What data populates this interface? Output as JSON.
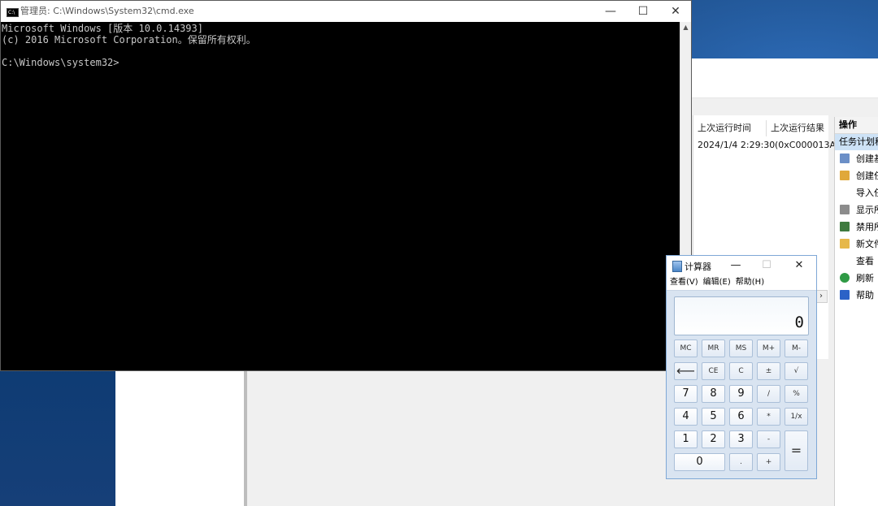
{
  "cmd": {
    "title": "管理员: C:\\Windows\\System32\\cmd.exe",
    "lines": [
      "Microsoft Windows [版本 10.0.14393]",
      "(c) 2016 Microsoft Corporation。保留所有权利。",
      "",
      "C:\\Windows\\system32>"
    ],
    "minimize": "—",
    "maximize": "☐",
    "close": "✕",
    "scroll_up": "▲"
  },
  "task_scheduler": {
    "columns": [
      "上次运行时间",
      "上次运行结果"
    ],
    "row": [
      "2024/1/4 2:29:30",
      "(0xC000013A"
    ],
    "scroll_right": "›",
    "actions_title": "操作",
    "actions_subtitle": "任务计划程",
    "actions": [
      {
        "label": "创建基",
        "icon": "create-basic-task-icon",
        "color": "#6b8fc7"
      },
      {
        "label": "创建任",
        "icon": "create-task-icon",
        "color": "#e0a83a"
      },
      {
        "label": "导入任",
        "icon": "",
        "color": ""
      },
      {
        "label": "显示所",
        "icon": "display-running-icon",
        "color": "#8c8c8c"
      },
      {
        "label": "禁用所",
        "icon": "disable-history-icon",
        "color": "#3e7a3e"
      },
      {
        "label": "新文件",
        "icon": "new-folder-icon",
        "color": "#e6b84a"
      },
      {
        "label": "查看",
        "icon": "",
        "color": ""
      },
      {
        "label": "刷新",
        "icon": "refresh-icon",
        "color": "#2f9a45"
      },
      {
        "label": "帮助",
        "icon": "help-icon",
        "color": "#2c62c7"
      }
    ]
  },
  "calculator": {
    "title": "计算器",
    "minimize": "—",
    "maximize": "☐",
    "close": "✕",
    "menu": [
      "查看(V)",
      "编辑(E)",
      "帮助(H)"
    ],
    "display": "0",
    "keys": {
      "mc": "MC",
      "mr": "MR",
      "ms": "MS",
      "mplus": "M+",
      "mminus": "M-",
      "back": "⟵",
      "ce": "CE",
      "c": "C",
      "plusminus": "±",
      "sqrt": "√",
      "n7": "7",
      "n8": "8",
      "n9": "9",
      "div": "/",
      "pct": "%",
      "n4": "4",
      "n5": "5",
      "n6": "6",
      "mul": "*",
      "inv": "1/x",
      "n1": "1",
      "n2": "2",
      "n3": "3",
      "sub": "-",
      "eq": "=",
      "n0": "0",
      "dot": ".",
      "add": "+"
    }
  }
}
